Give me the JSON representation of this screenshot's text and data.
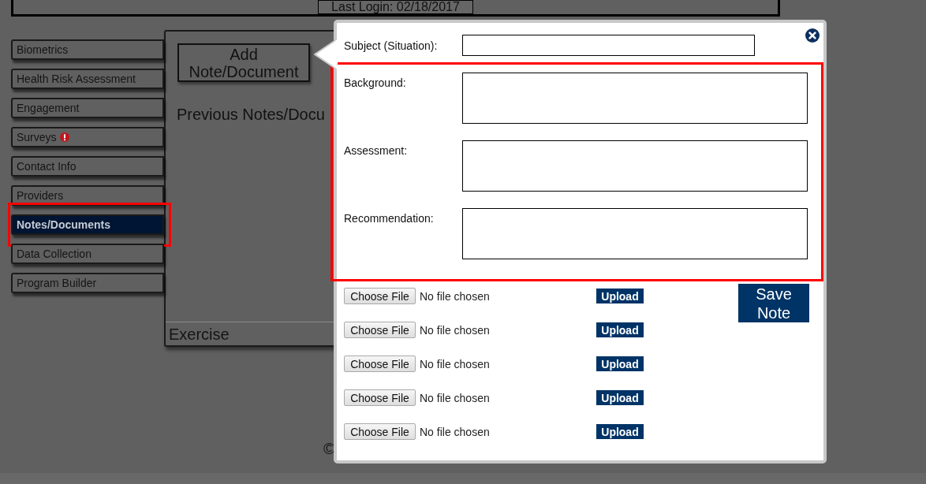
{
  "header": {
    "last_login": "Last Login: 02/18/2017"
  },
  "sidebar": {
    "items": [
      {
        "label": "Biometrics",
        "selected": false,
        "alert": false,
        "highlighted": false
      },
      {
        "label": "Health Risk Assessment",
        "selected": false,
        "alert": false,
        "highlighted": false
      },
      {
        "label": "Engagement",
        "selected": false,
        "alert": false,
        "highlighted": false
      },
      {
        "label": "Surveys",
        "selected": false,
        "alert": true,
        "highlighted": false
      },
      {
        "label": "Contact Info",
        "selected": false,
        "alert": false,
        "highlighted": false
      },
      {
        "label": "Providers",
        "selected": false,
        "alert": false,
        "highlighted": false
      },
      {
        "label": "Notes/Documents",
        "selected": true,
        "alert": false,
        "highlighted": true
      },
      {
        "label": "Data Collection",
        "selected": false,
        "alert": false,
        "highlighted": false
      },
      {
        "label": "Program Builder",
        "selected": false,
        "alert": false,
        "highlighted": false
      }
    ]
  },
  "panel": {
    "add_button": "Add Note/Document",
    "previous_heading": "Previous Notes/Docu",
    "section_title": "Exercise"
  },
  "footer": {
    "copyright": "©"
  },
  "modal": {
    "fields": [
      {
        "label": "Subject (Situation):",
        "kind": "line",
        "highlighted": false
      },
      {
        "label": "Background:",
        "kind": "box",
        "highlighted": true
      },
      {
        "label": "Assessment:",
        "kind": "box",
        "highlighted": true
      },
      {
        "label": "Recommendation:",
        "kind": "box",
        "highlighted": true
      }
    ],
    "uploads": [
      {
        "choose_label": "Choose File",
        "status": "No file chosen",
        "upload_label": "Upload"
      },
      {
        "choose_label": "Choose File",
        "status": "No file chosen",
        "upload_label": "Upload"
      },
      {
        "choose_label": "Choose File",
        "status": "No file chosen",
        "upload_label": "Upload"
      },
      {
        "choose_label": "Choose File",
        "status": "No file chosen",
        "upload_label": "Upload"
      },
      {
        "choose_label": "Choose File",
        "status": "No file chosen",
        "upload_label": "Upload"
      }
    ],
    "save_button": "Save Note"
  }
}
